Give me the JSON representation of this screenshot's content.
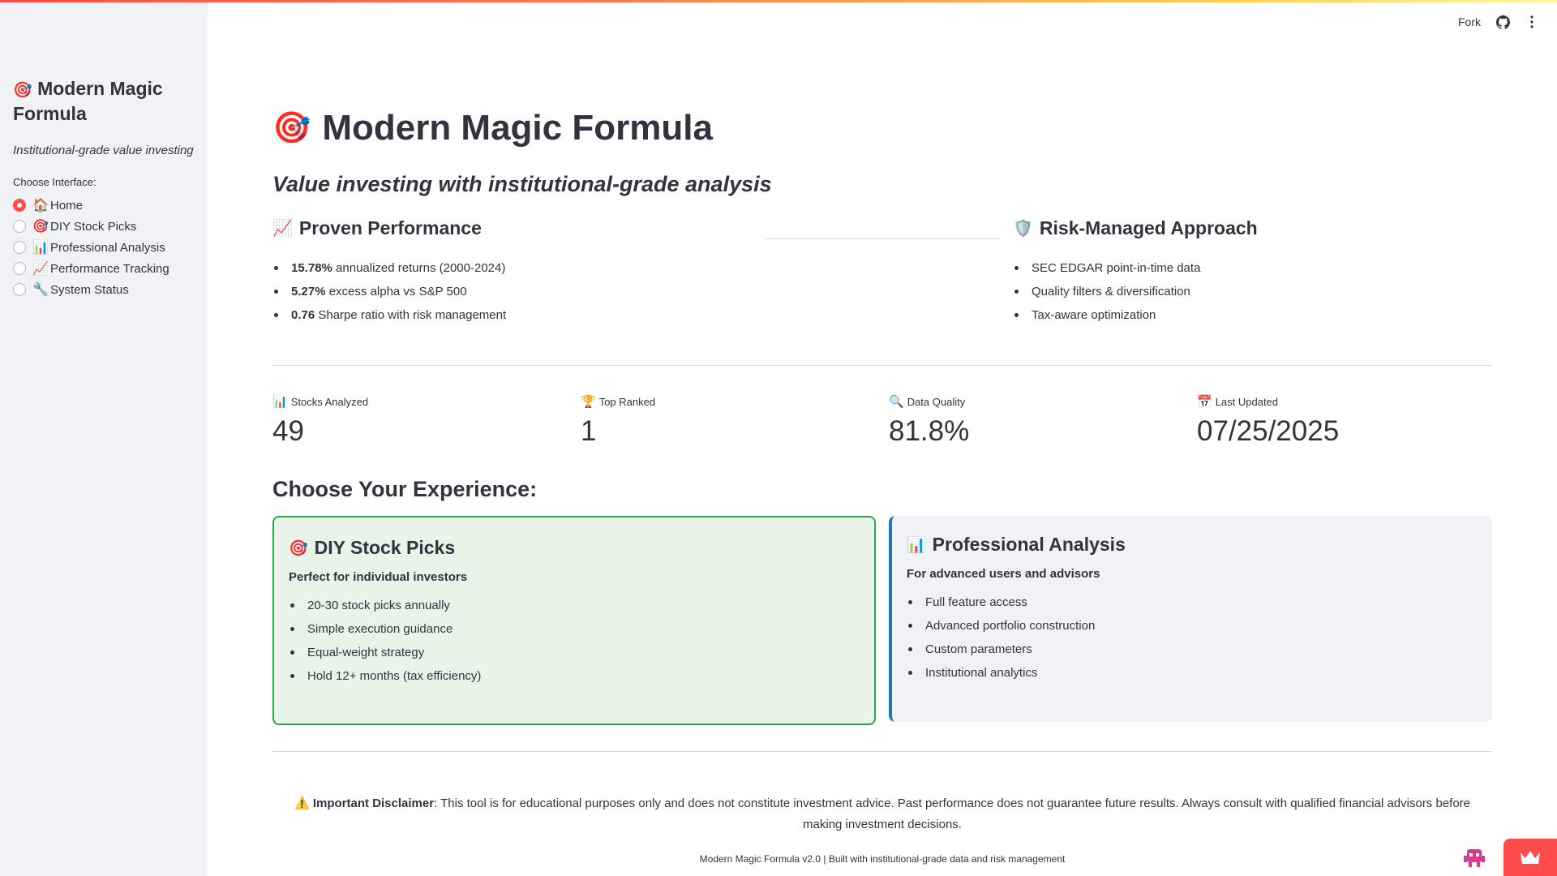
{
  "sidebar": {
    "title_emoji": "🎯",
    "title": "Modern Magic Formula",
    "subtitle": "Institutional-grade value investing",
    "choose_label": "Choose Interface:",
    "items": [
      {
        "emoji": "🏠",
        "label": "Home",
        "selected": true
      },
      {
        "emoji": "🎯",
        "label": "DIY Stock Picks",
        "selected": false
      },
      {
        "emoji": "📊",
        "label": "Professional Analysis",
        "selected": false
      },
      {
        "emoji": "📈",
        "label": "Performance Tracking",
        "selected": false
      },
      {
        "emoji": "🔧",
        "label": "System Status",
        "selected": false
      }
    ]
  },
  "toolbar": {
    "fork_label": "Fork",
    "github_icon": "github-icon",
    "menu_icon": "kebab-menu-icon"
  },
  "header": {
    "emoji": "🎯",
    "title": "Modern Magic Formula",
    "tagline": "Value investing with institutional-grade analysis"
  },
  "performance": {
    "emoji": "📈",
    "heading": "Proven Performance",
    "items": [
      {
        "bold": "15.78%",
        "text": " annualized returns (2000-2024)"
      },
      {
        "bold": "5.27%",
        "text": " excess alpha vs S&P 500"
      },
      {
        "bold": "0.76",
        "text": " Sharpe ratio with risk management"
      }
    ]
  },
  "risk": {
    "emoji": "🛡️",
    "heading": "Risk-Managed Approach",
    "items": [
      "SEC EDGAR point-in-time data",
      "Quality filters & diversification",
      "Tax-aware optimization"
    ]
  },
  "metrics": [
    {
      "emoji": "📊",
      "label": "Stocks Analyzed",
      "value": "49"
    },
    {
      "emoji": "🏆",
      "label": "Top Ranked",
      "value": "1"
    },
    {
      "emoji": "🔍",
      "label": "Data Quality",
      "value": "81.8%"
    },
    {
      "emoji": "📅",
      "label": "Last Updated",
      "value": "07/25/2025"
    }
  ],
  "experience": {
    "title": "Choose Your Experience:",
    "diy": {
      "emoji": "🎯",
      "title": "DIY Stock Picks",
      "subtitle": "Perfect for individual investors",
      "items": [
        "20-30 stock picks annually",
        "Simple execution guidance",
        "Equal-weight strategy",
        "Hold 12+ months (tax efficiency)"
      ]
    },
    "pro": {
      "emoji": "📊",
      "title": "Professional Analysis",
      "subtitle": "For advanced users and advisors",
      "items": [
        "Full feature access",
        "Advanced portfolio construction",
        "Custom parameters",
        "Institutional analytics"
      ]
    }
  },
  "disclaimer": {
    "emoji": "⚠️",
    "bold": "Important Disclaimer",
    "text": ": This tool is for educational purposes only and does not constitute investment advice. Past performance does not guarantee future results. Always consult with qualified financial advisors before making investment decisions."
  },
  "footer": "Modern Magic Formula v2.0 | Built with institutional-grade data and risk management",
  "colors": {
    "accent": "#ff4b4b",
    "diy_border": "#28a745",
    "pro_border": "#1f77b4",
    "sidebar_bg": "#f0f2f6"
  }
}
